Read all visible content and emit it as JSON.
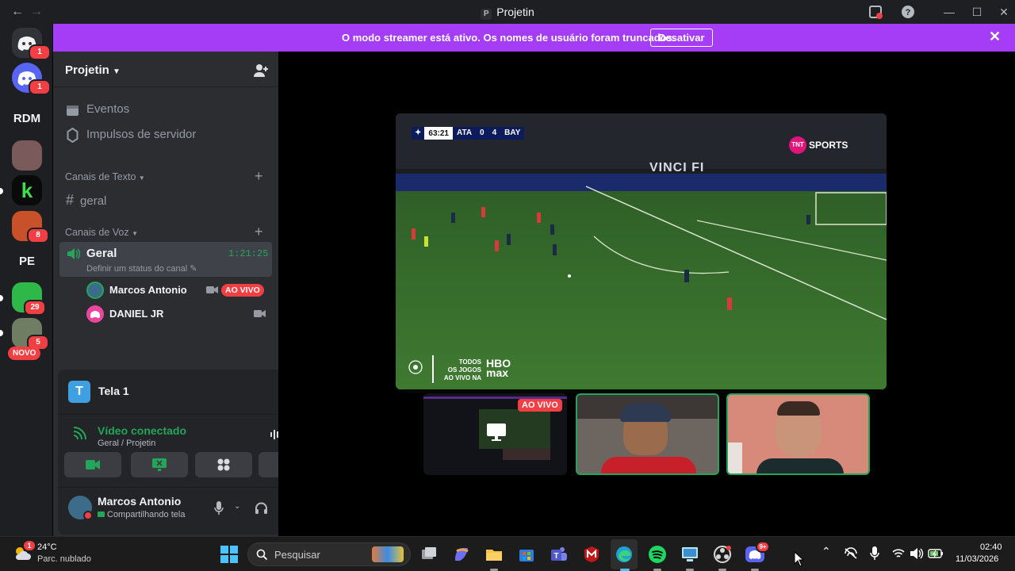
{
  "titlebar": {
    "title": "Projetin",
    "server_initial": "P"
  },
  "banner": {
    "message": "O modo streamer está ativo. Os nomes de usuário foram truncados.",
    "button": "Desativar"
  },
  "rail": {
    "dm_badge": "1",
    "discord_badge": "1",
    "servers": [
      {
        "label": "RDM"
      },
      {
        "label": "PE"
      }
    ],
    "badges": {
      "s4": "8",
      "s6": "29",
      "s7": "5"
    },
    "new_pill": "NOVO"
  },
  "sidebar": {
    "server_name": "Projetin",
    "events": "Eventos",
    "boosts": "Impulsos de servidor",
    "text_category": "Canais de Texto",
    "text_channel": "geral",
    "voice_category": "Canais de Voz",
    "voice_channel": "Geral",
    "voice_timer": "1:21:25",
    "voice_status": "Definir um status do canal",
    "members": [
      {
        "name": "Marcos Antonio",
        "live": "AO VIVO"
      },
      {
        "name": "DANIEL JR"
      }
    ]
  },
  "panel": {
    "stream_name": "Tela 1",
    "connection_status": "Vídeo conectado",
    "connection_location": "Geral / Projetin",
    "user_name": "Marcos Antonio",
    "user_status": "Compartilhando tela"
  },
  "stage": {
    "scoreboard": {
      "time": "63:21",
      "home": "ATA",
      "home_score": "0",
      "away_score": "4",
      "away": "BAY"
    },
    "broadcaster": "SPORTS",
    "broadcaster_badge": "TNT",
    "promo_line1": "TODOS",
    "promo_line2": "OS JOGOS",
    "promo_line3": "AO VIVO NA",
    "promo_brand_top": "HBO",
    "promo_brand_bottom": "max",
    "thumb_live": "AO VIVO",
    "ad_text": "VINCI FI"
  },
  "taskbar": {
    "temperature": "24°C",
    "weather": "Parc. nublado",
    "weather_badge": "1",
    "search": "Pesquisar",
    "discord_badge": "9+",
    "time": "02:40",
    "date": "11/03/2026"
  },
  "colors": {
    "accent": "#a53df7",
    "green": "#23a55a",
    "red": "#f23f43",
    "blurple": "#5865f2"
  }
}
